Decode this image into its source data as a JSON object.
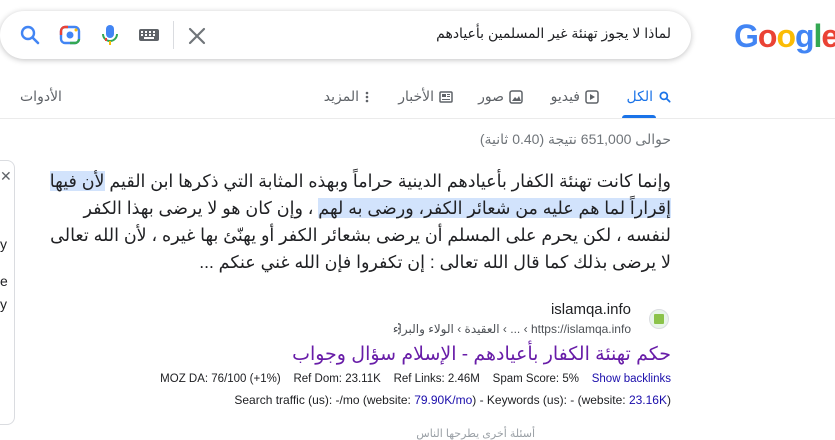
{
  "search": {
    "query": "لماذا لا يجوز تهنئة غير المسلمين بأعيادهم"
  },
  "logo": {
    "letters": [
      "G",
      "o",
      "o",
      "g",
      "l",
      "e"
    ],
    "colors": [
      "#4285f4",
      "#ea4335",
      "#fbbc05",
      "#4285f4",
      "#34a853",
      "#ea4335"
    ]
  },
  "tabs": {
    "all": "الكل",
    "videos": "فيديو",
    "images": "صور",
    "news": "الأخبار",
    "more": "المزيد",
    "tools": "الأدوات"
  },
  "stats": "حوالى 651,000 نتيجة (0.40 ثانية)",
  "snippet": {
    "part1": "وإنما كانت تهنئة الكفار بأعيادهم الدينية حراماً وبهذه المثابة التي ذكرها ابن القيم ",
    "highlight1": "لأن فيها إقراراً لما هم عليه من شعائر الكفر، ورضى به لهم",
    "part2": " ، وإن كان هو لا يرضى بهذا الكفر لنفسه ، لكن يحرم على المسلم أن يرضى بشعائر الكفر أو يهنّئ بها غيره ، لأن الله تعالى لا يرضى بذلك كما قال الله تعالى : إن تكفروا فإن الله غني عنكم ..."
  },
  "side_panel": {
    "close": "✕",
    "letters": [
      "y",
      "e",
      "y"
    ]
  },
  "result": {
    "site_name": "islamqa.info",
    "cite": "https://islamqa.info › ... › العقيدة › الولاء والبراء",
    "title": "حكم تهنئة الكفار بأعيادهم - الإسلام سؤال وجواب",
    "moz": {
      "da": "MOZ DA: 76/100 (+1%)",
      "ref_dom": "Ref Dom: 23.11K",
      "ref_links": "Ref Links: 2.46M",
      "spam": "Spam Score: 5%",
      "backlinks": "Show backlinks"
    },
    "traffic": {
      "prefix": "Search traffic (us): -/mo (website: ",
      "website": "79.90K/mo",
      "middle": ") - Keywords (us): - (website: ",
      "kw": "23.16K",
      "suffix": ")"
    }
  },
  "cut_text": "أسئلة أخرى يطرحها الناس"
}
